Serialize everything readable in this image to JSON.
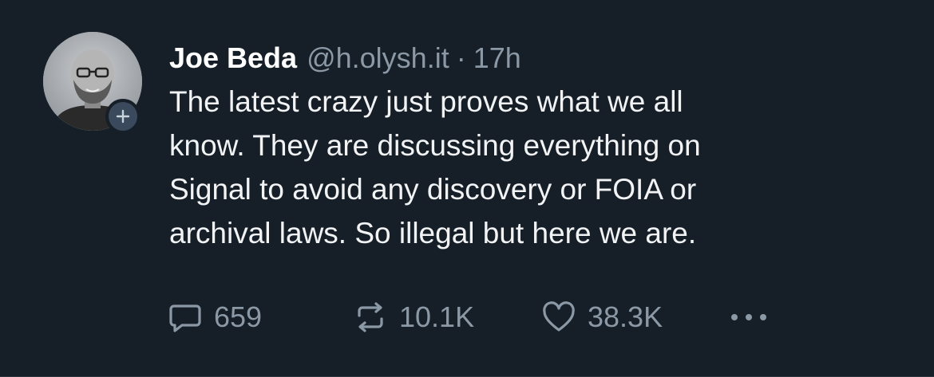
{
  "post": {
    "author": {
      "display_name": "Joe Beda",
      "handle": "@h.olysh.it",
      "separator": "·",
      "time": "17h",
      "avatar_icon": "profile-photo",
      "follow_icon": "plus-icon"
    },
    "text_lines": [
      "The latest crazy just proves what we all",
      "know. They are discussing everything on",
      "Signal to avoid any discovery or FOIA or",
      "archival laws. So illegal but here we are."
    ],
    "actions": {
      "reply": {
        "icon": "reply-icon",
        "count": "659"
      },
      "repost": {
        "icon": "repost-icon",
        "count": "10.1K"
      },
      "like": {
        "icon": "heart-icon",
        "count": "38.3K"
      },
      "more": {
        "icon": "more-icon"
      }
    }
  },
  "colors": {
    "background": "#161e27",
    "text_primary": "#ffffff",
    "text_secondary": "#8b98a5",
    "badge": "#3a4a5c"
  }
}
